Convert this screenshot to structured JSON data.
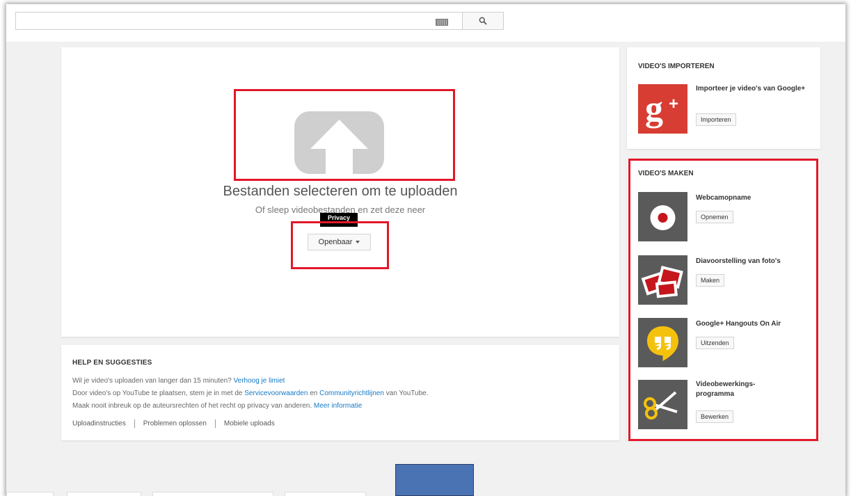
{
  "search": {
    "value": "",
    "placeholder": ""
  },
  "upload": {
    "title": "Bestanden selecteren om te uploaden",
    "subtitle": "Of sleep videobestanden en zet deze neer",
    "privacy_label": "Openbaar",
    "tooltip": "Privacy"
  },
  "help": {
    "title": "HELP EN SUGGESTIES",
    "line1_text": "Wil je video's uploaden van langer dan 15 minuten?",
    "line1_link": "Verhoog je limiet",
    "line2_pre": "Door video's op YouTube te plaatsen, stem je in met de",
    "line2_link1": "Servicevoorwaarden",
    "line2_mid": "en",
    "line2_link2": "Communityrichtlijnen",
    "line2_post": "van YouTube.",
    "line3_text": "Maak nooit inbreuk op de auteursrechten of het recht op privacy van anderen.",
    "line3_link": "Meer informatie",
    "links": [
      "Uploadinstructies",
      "Problemen oplossen",
      "Mobiele uploads"
    ]
  },
  "import": {
    "heading": "VIDEO'S IMPORTEREN",
    "logo_text": "g+",
    "item_title": "Importeer je video's van Google+",
    "button": "Importeren"
  },
  "create": {
    "heading": "VIDEO'S MAKEN",
    "items": [
      {
        "title": "Webcamopname",
        "button": "Opnemen",
        "icon": "webcam-record-icon"
      },
      {
        "title": "Diavoorstelling van foto's",
        "button": "Maken",
        "icon": "photo-slideshow-icon"
      },
      {
        "title": "Google+ Hangouts On Air",
        "button": "Uitzenden",
        "icon": "hangouts-icon"
      },
      {
        "title": "Videobewerkings-programma",
        "button": "Bewerken",
        "icon": "scissors-icon"
      }
    ]
  },
  "colors": {
    "highlight": "#e2172a",
    "link": "#167ac6",
    "gplus": "#d73d32",
    "thumb_bg": "#5a5a5a",
    "hangouts_yellow": "#f4c20d",
    "callout_blue": "#4a73b3"
  }
}
